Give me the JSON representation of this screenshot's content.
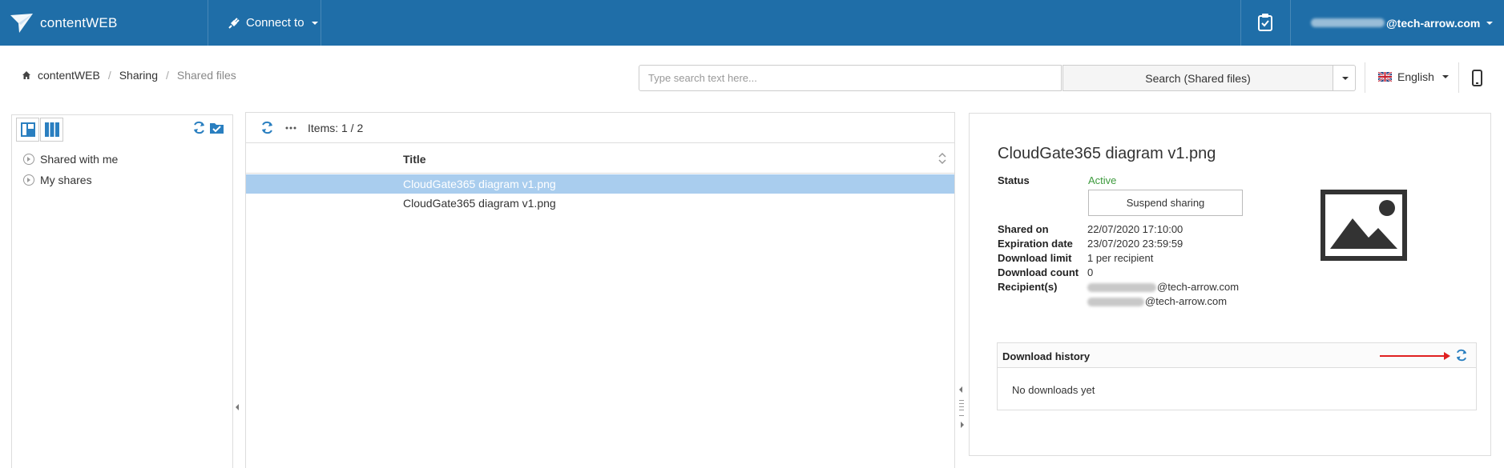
{
  "app": {
    "brand": "contentWEB",
    "connect_label": "Connect to",
    "user_domain": "@tech-arrow.com"
  },
  "breadcrumb": [
    "contentWEB",
    "Sharing",
    "Shared files"
  ],
  "search": {
    "placeholder": "Type search text here...",
    "button_label": "Search (Shared files)"
  },
  "language": "English",
  "tree": {
    "items": [
      "Shared with me",
      "My shares"
    ]
  },
  "grid": {
    "items_label": "Items: 1 / 2",
    "column_title": "Title",
    "rows": [
      "CloudGate365 diagram v1.png",
      "CloudGate365 diagram v1.png"
    ]
  },
  "detail": {
    "title": "CloudGate365 diagram v1.png",
    "status_label": "Status",
    "status_value": "Active",
    "suspend_label": "Suspend sharing",
    "shared_on_label": "Shared on",
    "shared_on_value": "22/07/2020 17:10:00",
    "expiration_label": "Expiration date",
    "expiration_value": "23/07/2020 23:59:59",
    "download_limit_label": "Download limit",
    "download_limit_value": "1 per recipient",
    "download_count_label": "Download count",
    "download_count_value": "0",
    "recipients_label": "Recipient(s)",
    "recipients": [
      "@tech-arrow.com",
      "@tech-arrow.com"
    ],
    "history_title": "Download history",
    "history_empty": "No downloads yet"
  },
  "colors": {
    "topbar": "#1f6ea8",
    "accent": "#2a7fc0",
    "selected_row": "#a9cdee",
    "active_status": "#3d9a3d",
    "annotation_arrow": "#e02020"
  }
}
